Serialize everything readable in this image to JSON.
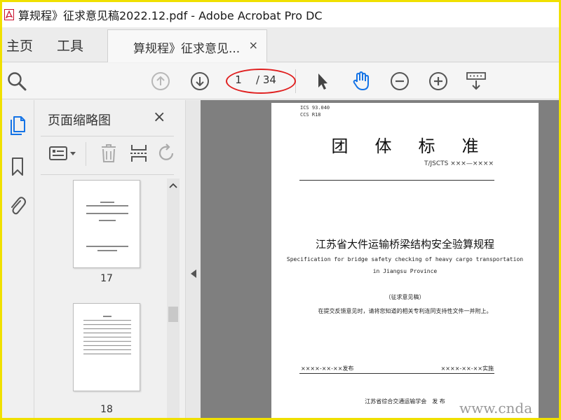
{
  "window": {
    "title": "算规程》征求意见稿2022.12.pdf - Adobe Acrobat Pro DC"
  },
  "nav": {
    "home": "主页",
    "tools": "工具",
    "doc_tab_label": "算规程》征求意见...",
    "doc_tab_close": "×"
  },
  "toolbar": {
    "current_page": "1",
    "page_total": "/ 34"
  },
  "thumbnails_panel": {
    "title": "页面缩略图",
    "close": "×",
    "items": [
      {
        "label": "17"
      },
      {
        "label": "18"
      }
    ]
  },
  "document": {
    "ics": "ICS 93.040",
    "ccs": "CCS R18",
    "heading": "团体标准",
    "code": "T/JSCTS ×××—××××",
    "title_cn": "江苏省大件运输桥梁结构安全验算规程",
    "title_en_line1": "Specification for bridge safety checking of heavy cargo transportation",
    "title_en_line2": "in Jiangsu Province",
    "status": "（征求意见稿）",
    "notice": "在提交反馈意见时，请将您知道的相关专利连同支持性文件一并附上。",
    "issue_date": "××××-××-××发布",
    "implement_date": "××××-××-××实施",
    "publisher": "江苏省综合交通运输学会　发 布"
  },
  "watermark": "www.cnda",
  "colors": {
    "highlight_ellipse": "#e02020",
    "accent_blue": "#1473e6",
    "icon_gray": "#555555"
  }
}
